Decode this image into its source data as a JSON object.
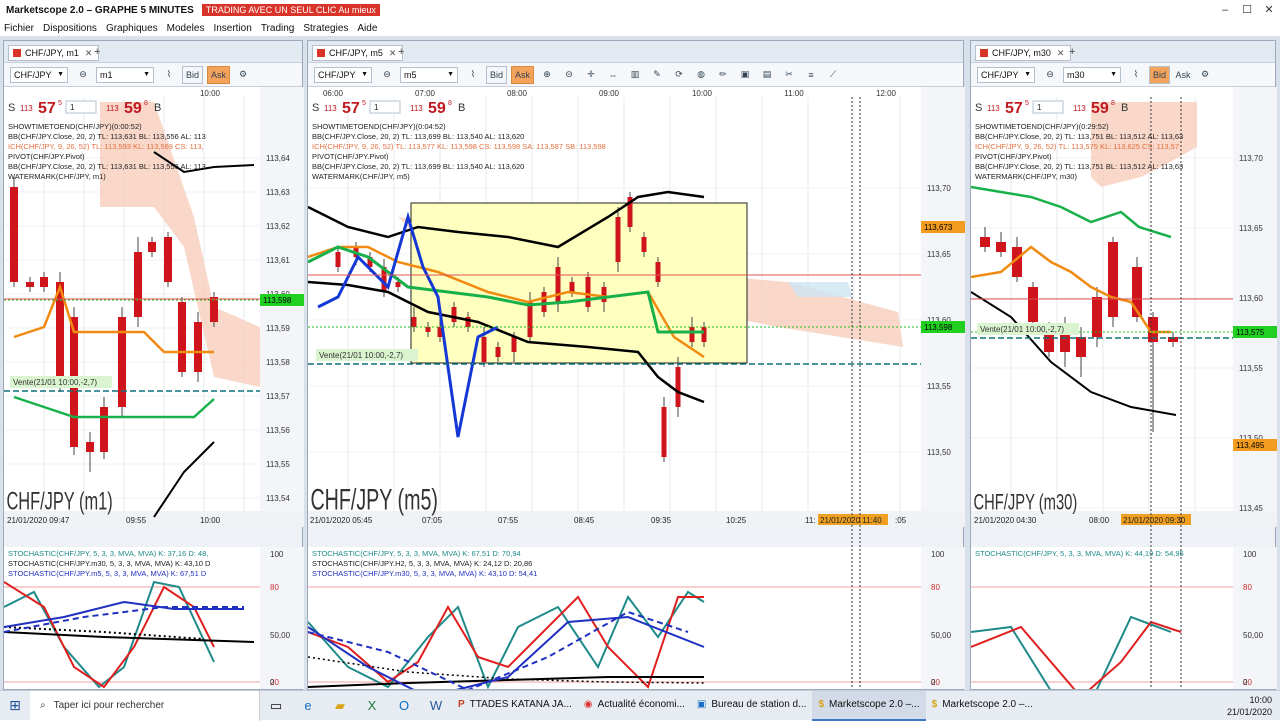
{
  "app": {
    "title": "Marketscope 2.0 – GRAPHE 5 MINUTES",
    "promo": "TRADING AVEC UN SEUL CLIC Au mieux"
  },
  "menu": [
    "Fichier",
    "Dispositions",
    "Graphiques",
    "Modeles",
    "Insertion",
    "Trading",
    "Strategies",
    "Aide"
  ],
  "panels": [
    {
      "tab": "CHF/JPY, m1",
      "symbol": "CHF/JPY",
      "timeframe": "m1",
      "time_labels": [
        "10:00"
      ],
      "bottom_time_labels": [
        "21/01/2020 09:47",
        "09:55",
        "10:00"
      ],
      "price_labels": [
        "113,64",
        "113,63",
        "113,62",
        "113,61",
        "113,60",
        "113,59",
        "113,58",
        "113,57",
        "113,56",
        "113,55",
        "113,54"
      ],
      "current_price_tag": "113,598",
      "sell_big": "57",
      "sell_prefix": "113",
      "sell_sup": "5",
      "buy_big": "59",
      "buy_prefix": "113",
      "buy_sup": "8",
      "indicators": [
        "SHOWTIMETOEND(CHF/JPY)(0:00:52)",
        "BB(CHF/JPY.Close, 20, 2)  TL: 113,631  BL: 113,556  AL: 113",
        "ICH(CHF/JPY, 9, 26, 52)  TL: 113,593  KL: 113,569  CS: 113,",
        "PIVOT(CHF/JPY.Pivot)",
        "BB(CHF/JPY.Close, 20, 2)  TL: 113,631  BL: 113,556  AL: 113",
        "WATERMARK(CHF/JPY, m1)"
      ],
      "order_label": "Vente(21/01 10:00,-2,7)",
      "watermark": "CHF/JPY (m1)",
      "stoch": [
        "STOCHASTIC(CHF/JPY, 5, 3, 3, MVA, MVA)  K: 37,16  D: 48,",
        "STOCHASTIC(CHF/JPY.m30, 5, 3, 3, MVA, MVA)  K: 43,10  D",
        "STOCHASTIC(CHF/JPY.m5, 5, 3, 3, MVA, MVA)  K: 67,51  D"
      ],
      "stoch_scale": [
        "100",
        "80",
        "50,00",
        "20",
        "0"
      ]
    },
    {
      "tab": "CHF/JPY, m5",
      "symbol": "CHF/JPY",
      "timeframe": "m5",
      "time_labels": [
        "06:00",
        "07:00",
        "08:00",
        "09:00",
        "10:00",
        "11:00",
        "12:00"
      ],
      "bottom_time_labels": [
        "21/01/2020 05:45",
        "07:05",
        "07:55",
        "08:45",
        "09:35",
        "10:25",
        "11:",
        "21/01/2020 11:40",
        ":05"
      ],
      "price_labels": [
        "113,70",
        "113,65",
        "113,60",
        "113,55",
        "113,50"
      ],
      "current_price_tag": "113,598",
      "top_price_tag": "113,673",
      "sell_big": "57",
      "sell_prefix": "113",
      "sell_sup": "5",
      "buy_big": "59",
      "buy_prefix": "113",
      "buy_sup": "8",
      "indicators": [
        "SHOWTIMETOEND(CHF/JPY)(0:04:52)",
        "BB(CHF/JPY.Close, 20, 2)  TL: 113,699  BL: 113,540  AL: 113,620",
        "ICH(CHF/JPY, 9, 26, 52)  TL: 113,577  KL: 113,598  CS: 113,598  SA: 113,587  SB: 113,598",
        "PIVOT(CHF/JPY.Pivot)",
        "BB(CHF/JPY.Close, 20, 2)  TL: 113,699  BL: 113,540  AL: 113,620",
        "WATERMARK(CHF/JPY, m5)"
      ],
      "order_label": "Vente(21/01 10:00,-2,7)",
      "watermark": "CHF/JPY (m5)",
      "stoch": [
        "STOCHASTIC(CHF/JPY, 5, 3, 3, MVA, MVA)  K: 67,51  D: 70,94",
        "STOCHASTIC(CHF/JPY.H2, 5, 3, 3, MVA, MVA)  K: 24,12  D: 20,86",
        "STOCHASTIC(CHF/JPY.m30, 5, 3, 3, MVA, MVA)  K: 43,10  D: 54,41"
      ],
      "stoch_scale": [
        "100",
        "80",
        "50,00",
        "20",
        "0"
      ]
    },
    {
      "tab": "CHF/JPY, m30",
      "symbol": "CHF/JPY",
      "timeframe": "m30",
      "time_labels": [],
      "bottom_time_labels": [
        "21/01/2020 04:30",
        "08:00",
        "21/01/2020 09:30"
      ],
      "price_labels": [
        "113,70",
        "113,65",
        "113,60",
        "113,55",
        "113,50",
        "113,45"
      ],
      "current_price_tag": "113,575",
      "low_price_tag": "113,495",
      "sell_big": "57",
      "sell_prefix": "113",
      "sell_sup": "5",
      "buy_big": "59",
      "buy_prefix": "113",
      "buy_sup": "8",
      "indicators": [
        "SHOWTIMETOEND(CHF/JPY)(0:29:52)",
        "BB(CHF/JPY.Close, 20, 2)  TL: 113,751  BL: 113,512  AL: 113,63",
        "ICH(CHF/JPY, 9, 26, 52)  TL: 113,575  KL: 113,625  CS: 113,57",
        "PIVOT(CHF/JPY.Pivot)",
        "BB(CHF/JPY.Close, 20, 2)  TL: 113,751  BL: 113,512  AL: 113,63",
        "WATERMARK(CHF/JPY, m30)"
      ],
      "order_label": "Vente(21/01 10:00,-2,7)",
      "watermark": "CHF/JPY (m30)",
      "stoch": [
        "STOCHASTIC(CHF/JPY, 5, 3, 3, MVA, MVA)  K: 44,19  D: 54,95"
      ],
      "stoch_scale": [
        "100",
        "80",
        "50,00",
        "20",
        "0"
      ]
    }
  ],
  "toolbar": {
    "bid": "Bid",
    "ask": "Ask",
    "s_label": "S",
    "b_label": "B",
    "spin": "1"
  },
  "taskbar": {
    "search_placeholder": "Taper ici pour rechercher",
    "apps": [
      "TTADES KATANA JA...",
      "Actualité économi...",
      "Bureau de station d...",
      "Marketscope 2.0 –...",
      "Marketscope 2.0 –..."
    ],
    "time": "10:00",
    "date": "21/01/2020"
  },
  "colors": {
    "bull": "#1f6fc8",
    "bear": "#d0141c",
    "kijun": "#18b04a",
    "tenkan": "#f08a10",
    "box": "#ffffc0",
    "ask": "#f4a35c"
  }
}
